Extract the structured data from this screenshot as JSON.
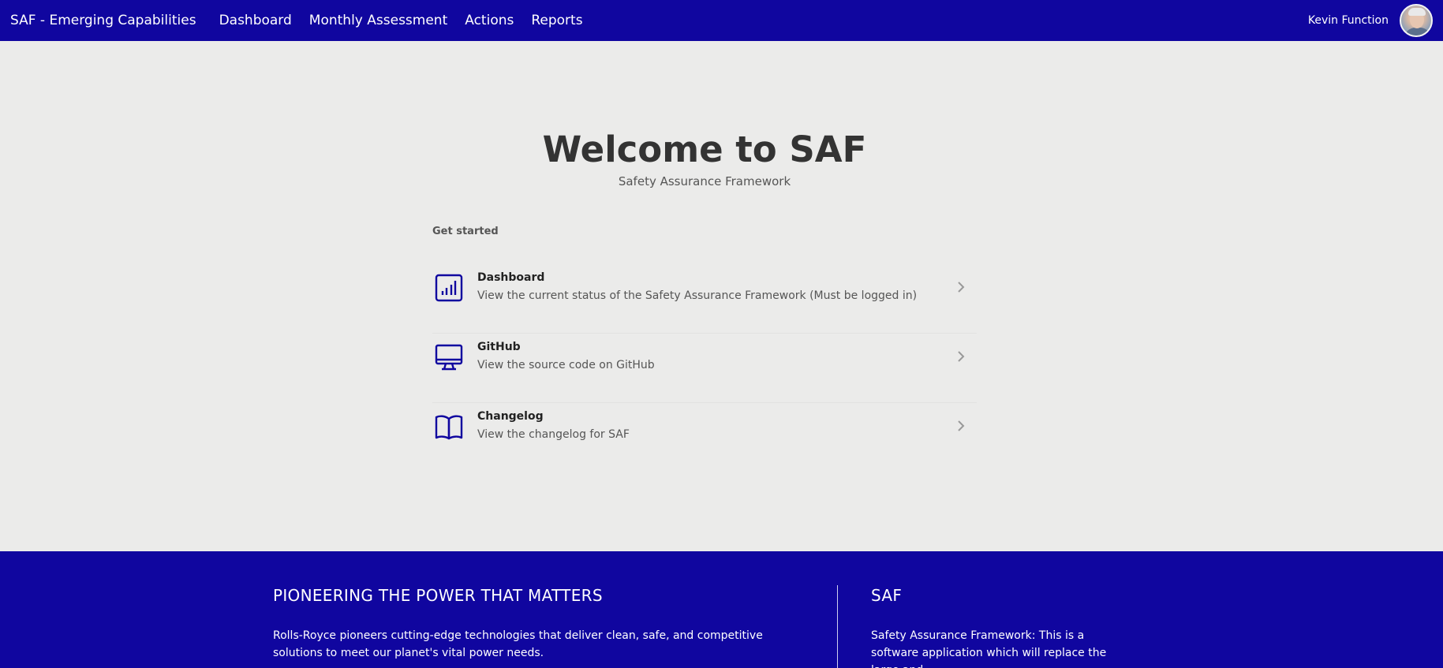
{
  "navbar": {
    "brand": "SAF - Emerging Capabilities",
    "links": [
      "Dashboard",
      "Monthly Assessment",
      "Actions",
      "Reports"
    ],
    "user_name": "Kevin Function"
  },
  "hero": {
    "title": "Welcome to SAF",
    "subtitle": "Safety Assurance Framework",
    "section_label": "Get started",
    "items": [
      {
        "title": "Dashboard",
        "description": "View the current status of the Safety Assurance Framework (Must be logged in)",
        "icon": "bar-chart-icon"
      },
      {
        "title": "GitHub",
        "description": "View the source code on GitHub",
        "icon": "monitor-icon"
      },
      {
        "title": "Changelog",
        "description": "View the changelog for SAF",
        "icon": "book-open-icon"
      }
    ]
  },
  "footer": {
    "left_heading": "PIONEERING THE POWER THAT MATTERS",
    "left_text": "Rolls-Royce pioneers cutting-edge technologies that deliver clean, safe, and competitive solutions to meet our planet's vital power needs.",
    "right_heading": "SAF",
    "right_text": "Safety Assurance Framework: This is a software application which will replace the large and"
  },
  "colors": {
    "brand_blue": "#10069f",
    "page_background": "#ebebea"
  }
}
